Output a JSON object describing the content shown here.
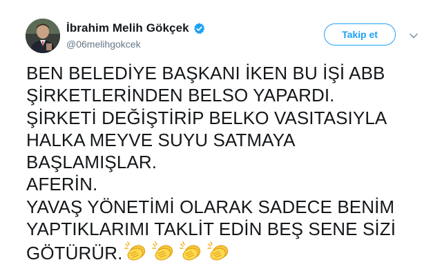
{
  "author": {
    "display_name": "İbrahim Melih Gökçek",
    "handle": "@06melihgokcek",
    "verified": true,
    "avatar_icon": "profile-photo"
  },
  "actions": {
    "follow_label": "Takip et",
    "menu_icon": "chevron-down-icon"
  },
  "tweet": {
    "lines": [
      "BEN BELEDİYE BAŞKANI İKEN BU İŞİ ABB",
      "ŞİRKETLERİNDEN BELSO YAPARDI.",
      "ŞİRKETİ DEĞİŞTİRİP BELKO VASITASIYLA",
      "HALKA MEYVE SUYU SATMAYA",
      "BAŞLAMIŞLAR.",
      "AFERİN.",
      "YAVAŞ YÖNETİMİ OLARAK SADECE BENİM",
      "YAPTIKLARIMI TAKLİT EDİN BEŞ SENE SİZİ",
      "GÖTÜRÜR."
    ],
    "emoji": [
      "clapping-hands",
      "clapping-hands",
      "clapping-hands",
      "clapping-hands"
    ]
  },
  "colors": {
    "accent": "#1da1f2",
    "text": "#14171a",
    "secondary": "#657786"
  }
}
